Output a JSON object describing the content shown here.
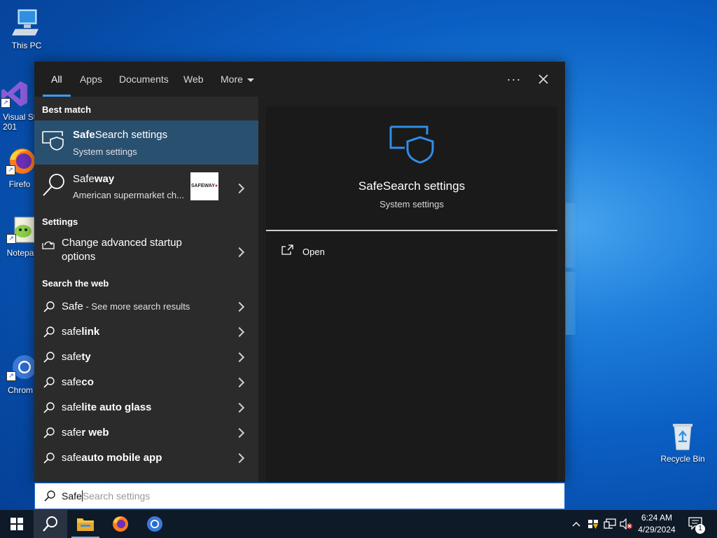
{
  "desktop": {
    "icons": [
      {
        "label": "This PC"
      },
      {
        "label": "Visual St 201"
      },
      {
        "label": "Firefo"
      },
      {
        "label": "Notepa"
      },
      {
        "label": "Chrom"
      },
      {
        "label": "Recycle Bin"
      }
    ]
  },
  "search": {
    "tabs": [
      "All",
      "Apps",
      "Documents",
      "Web",
      "More"
    ],
    "active_tab": "All",
    "sections": {
      "best_match": "Best match",
      "settings": "Settings",
      "web": "Search the web"
    },
    "best_match": {
      "title_bold": "Safe",
      "title_rest": "Search settings",
      "subtitle": "System settings"
    },
    "safeway": {
      "title_plain": "Safe",
      "title_bold": "way",
      "subtitle": "American supermarket ch...",
      "logo_text": "SAFEWAY"
    },
    "settings_item": {
      "line1": "Change advanced startup",
      "line2": "options"
    },
    "web_results": [
      {
        "plain": "Safe",
        "bold": "",
        "suffix": " - See more search results"
      },
      {
        "plain": "safe",
        "bold": "link",
        "suffix": ""
      },
      {
        "plain": "safe",
        "bold": "ty",
        "suffix": ""
      },
      {
        "plain": "safe",
        "bold": "co",
        "suffix": ""
      },
      {
        "plain": "safe",
        "bold": "lite auto glass",
        "suffix": ""
      },
      {
        "plain": "safe",
        "bold": "r web",
        "suffix": ""
      },
      {
        "plain": "safe",
        "bold": "auto mobile app",
        "suffix": ""
      }
    ],
    "detail": {
      "title": "SafeSearch settings",
      "subtitle": "System settings",
      "action": "Open"
    },
    "query": {
      "typed": "Safe",
      "completion": "Search settings"
    }
  },
  "taskbar": {
    "time": "6:24 AM",
    "date": "4/29/2024",
    "notification_count": "1"
  },
  "colors": {
    "accent": "#3b9bff",
    "selected_row": "#2a5070",
    "flyout_bg": "#1f1f1f"
  }
}
